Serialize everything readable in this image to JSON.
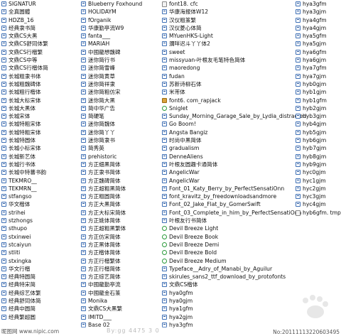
{
  "col1": [
    {
      "t": "SIGNATUR",
      "i": "ttf"
    },
    {
      "t": "全真圆體",
      "i": "ttf"
    },
    {
      "t": "HDZB_16",
      "i": "ttf"
    },
    {
      "t": "经典隶书简",
      "i": "ttf"
    },
    {
      "t": "文鼎CS大黑",
      "i": "ttf"
    },
    {
      "t": "文鼎CS舒同体繁",
      "i": "ttf"
    },
    {
      "t": "文鼎CS行楷繁",
      "i": "ttf"
    },
    {
      "t": "文鼎CS中等",
      "i": "ttf"
    },
    {
      "t": "文鼎CS行楷体简",
      "i": "ttf"
    },
    {
      "t": "长城粗隶书体",
      "i": "ttf"
    },
    {
      "t": "长城粗魏碑体",
      "i": "ttf"
    },
    {
      "t": "长城粗行楷体",
      "i": "ttf"
    },
    {
      "t": "长城大标宋体",
      "i": "ttf"
    },
    {
      "t": "长城大黑体",
      "i": "ttf"
    },
    {
      "t": "长城宋体",
      "i": "ttf"
    },
    {
      "t": "长城特粗宋体",
      "i": "ttf"
    },
    {
      "t": "长城特粗宋体",
      "i": "ttf"
    },
    {
      "t": "长城特圆体",
      "i": "ttf"
    },
    {
      "t": "长城小标宋体",
      "i": "ttf"
    },
    {
      "t": "长城新艺体",
      "i": "ttf"
    },
    {
      "t": "长城行书体",
      "i": "ttf"
    },
    {
      "t": "长城中特蕃书韵",
      "i": "ttf"
    },
    {
      "t": "TEKMRO__",
      "i": "ttf"
    },
    {
      "t": "TEKMRN__",
      "i": "ttf"
    },
    {
      "t": "stfangso",
      "i": "ttf"
    },
    {
      "t": "华文楷体",
      "i": "ttf"
    },
    {
      "t": "strihei",
      "i": "ttf"
    },
    {
      "t": "stzhongs",
      "i": "ttf"
    },
    {
      "t": "sthupo",
      "i": "ttf"
    },
    {
      "t": "stxinwei",
      "i": "ttf"
    },
    {
      "t": "stcaiyun",
      "i": "ttf"
    },
    {
      "t": "stliti",
      "i": "ttf"
    },
    {
      "t": "stxingka",
      "i": "ttf"
    },
    {
      "t": "华文行楷",
      "i": "ttf"
    },
    {
      "t": "经典特圆简",
      "i": "ttf"
    },
    {
      "t": "经典特宋简",
      "i": "ttf"
    },
    {
      "t": "经典综艺体繁",
      "i": "ttf"
    },
    {
      "t": "经典舒同体简",
      "i": "ttf"
    },
    {
      "t": "经典中圆简",
      "i": "ttf"
    },
    {
      "t": "经典繁超圆",
      "i": "ttf"
    }
  ],
  "col2": [
    {
      "t": "Blueberry Foxhound",
      "i": "ttf"
    },
    {
      "t": "HOLIDAYM",
      "i": "ttf"
    },
    {
      "t": "fOrganik",
      "i": "ttf"
    },
    {
      "t": "华康勤亭流W9",
      "i": "ttf"
    },
    {
      "t": "fanta___",
      "i": "ttf"
    },
    {
      "t": "MARIAH",
      "i": "ttf"
    },
    {
      "t": "中國龍想魏碑",
      "i": "ttf"
    },
    {
      "t": "迷你简行书",
      "i": "ttf"
    },
    {
      "t": "迷你简雪峰",
      "i": "ttf"
    },
    {
      "t": "迷你简黄草",
      "i": "ttf"
    },
    {
      "t": "迷你简祥隶",
      "i": "ttf"
    },
    {
      "t": "迷你简粗仿宋",
      "i": "ttf"
    },
    {
      "t": "迷你简大黑",
      "i": "ttf"
    },
    {
      "t": "简中华广告",
      "i": "ttf"
    },
    {
      "t": "简硬笔",
      "i": "ttf"
    },
    {
      "t": "迷你简魏体",
      "i": "ttf"
    },
    {
      "t": "迷你简丫丫",
      "i": "ttf"
    },
    {
      "t": "迷你简隶书",
      "i": "ttf"
    },
    {
      "t": "简秀英",
      "i": "ttf"
    },
    {
      "t": "prehistoric",
      "i": "ttf"
    },
    {
      "t": "方正细黑简体",
      "i": "ttf"
    },
    {
      "t": "方正隶书简体",
      "i": "ttf"
    },
    {
      "t": "方正魏碑简体",
      "i": "ttf"
    },
    {
      "t": "方正超粗黑简体",
      "i": "ttf"
    },
    {
      "t": "方正粗圆简体",
      "i": "ttf"
    },
    {
      "t": "方正大黑简体",
      "i": "ttf"
    },
    {
      "t": "方正大标宋简体",
      "i": "ttf"
    },
    {
      "t": "方正姚体简体",
      "i": "ttf"
    },
    {
      "t": "方正超粗黑繁体",
      "i": "ttf"
    },
    {
      "t": "方正仿宋简体",
      "i": "ttf"
    },
    {
      "t": "方正黑体简体",
      "i": "ttf"
    },
    {
      "t": "方正楷体简体",
      "i": "ttf"
    },
    {
      "t": "方正行楷繁体",
      "i": "ttf"
    },
    {
      "t": "方正行楷简体",
      "i": "ttf"
    },
    {
      "t": "方正综艺简体",
      "i": "ttf"
    },
    {
      "t": "中國龍勤亭流",
      "i": "ttf"
    },
    {
      "t": "中國龍金石篆",
      "i": "ttf"
    },
    {
      "t": "Monika",
      "i": "ttf"
    },
    {
      "t": "文鼎CS大黑繁",
      "i": "ttf"
    },
    {
      "t": "IMITD___",
      "i": "ttf"
    },
    {
      "t": "Base 02",
      "i": "ttf"
    }
  ],
  "col3": [
    {
      "t": "font18. cfc",
      "i": "file"
    },
    {
      "t": "华康海报体W12",
      "i": "ttf"
    },
    {
      "t": "汉仪粗篆繁",
      "i": "ttf"
    },
    {
      "t": "汉仪菱心体简",
      "i": "ttf"
    },
    {
      "t": "MYuenHKS-Light",
      "i": "ttf"
    },
    {
      "t": "瀰咩迟斗丫丫体2",
      "i": "ttf"
    },
    {
      "t": "sweet",
      "i": "ttf"
    },
    {
      "t": "missyuan-叶根友毛笔特色简体",
      "i": "ttf"
    },
    {
      "t": "maoredong",
      "i": "ttf"
    },
    {
      "t": "fudan",
      "i": "ttf"
    },
    {
      "t": "苏新诗柳石体",
      "i": "ttf"
    },
    {
      "t": "米芾体",
      "i": "ttf"
    },
    {
      "t": "font6. com_rapjack",
      "i": "fon"
    },
    {
      "t": "Sniglet",
      "i": "otf"
    },
    {
      "t": "Sunday_Morning_Garage_Sale_by_Lydia_distracted",
      "i": "ttf"
    },
    {
      "t": "Go Boom!",
      "i": "ttf"
    },
    {
      "t": "Angsta Bangiz",
      "i": "ttf"
    },
    {
      "t": "时尚中黑简体",
      "i": "ttf"
    },
    {
      "t": "gradualism",
      "i": "ttf"
    },
    {
      "t": "DenneAliens",
      "i": "ttf"
    },
    {
      "t": "叶根友圆趣卡通简体",
      "i": "ttf"
    },
    {
      "t": "AngelicWar",
      "i": "ttf"
    },
    {
      "t": "AngelicWar",
      "i": "ttf"
    },
    {
      "t": "Font_01_Katy_Berry_by_PerfectSensatiOnn",
      "i": "ttf"
    },
    {
      "t": "font_kravitz_by_freedownloadsandmore",
      "i": "ttf"
    },
    {
      "t": "Font_02_Jake_Flat_by_GomerSwift",
      "i": "ttf"
    },
    {
      "t": "Font_03_Complete_in_him_by_PerfectSensatiOnn",
      "i": "ttf"
    },
    {
      "t": "叶根友行书简体",
      "i": "ttf"
    },
    {
      "t": "Devil Breeze Light",
      "i": "otf"
    },
    {
      "t": "Devil Breeze Book",
      "i": "otf"
    },
    {
      "t": "Devil Breeze Demi",
      "i": "otf"
    },
    {
      "t": "Devil Breeze Bold",
      "i": "otf"
    },
    {
      "t": "Devil Breeze Medium",
      "i": "otf"
    },
    {
      "t": "Typeface__Adry_of_Manabi_by_Aguilur",
      "i": "ttf"
    },
    {
      "t": "skirules_sans2_ttf_download_by_protofonts",
      "i": "ttf"
    },
    {
      "t": "文鼎CS楷体",
      "i": "ttf"
    },
    {
      "t": "hya0gfm",
      "i": "ttf"
    },
    {
      "t": "hya0gjm",
      "i": "ttf"
    },
    {
      "t": "hya1gfm",
      "i": "ttf"
    },
    {
      "t": "hya2gjm",
      "i": "ttf"
    },
    {
      "t": "hya3gfm",
      "i": "ttf"
    }
  ],
  "col4": [
    {
      "t": "hya3gfm",
      "i": "ttf"
    },
    {
      "t": "hya3gjm",
      "i": "ttf"
    },
    {
      "t": "hya4gfm",
      "i": "ttf"
    },
    {
      "t": "hya4gjm",
      "i": "ttf"
    },
    {
      "t": "hya5gfm",
      "i": "ttf"
    },
    {
      "t": "hya5gjm",
      "i": "ttf"
    },
    {
      "t": "hya6gfm",
      "i": "ttf"
    },
    {
      "t": "hya6gjm",
      "i": "ttf"
    },
    {
      "t": "hya7gfm",
      "i": "ttf"
    },
    {
      "t": "hya7gjm",
      "i": "ttf"
    },
    {
      "t": "hyb0gjm",
      "i": "ttf"
    },
    {
      "t": "hyb1gjm",
      "i": "ttf"
    },
    {
      "t": "hyb1gfm",
      "i": "ttf"
    },
    {
      "t": "hyb2gjm",
      "i": "ttf"
    },
    {
      "t": "hyb3gjm",
      "i": "ttf"
    },
    {
      "t": "hyb4gjm",
      "i": "ttf"
    },
    {
      "t": "hyb5gjm",
      "i": "ttf"
    },
    {
      "t": "hyb6gjm",
      "i": "ttf"
    },
    {
      "t": "hyb7gjm",
      "i": "ttf"
    },
    {
      "t": "hyb8gjm",
      "i": "ttf"
    },
    {
      "t": "hyb9gjm",
      "i": "ttf"
    },
    {
      "t": "hyc0gjm",
      "i": "ttf"
    },
    {
      "t": "hyc1gjm",
      "i": "ttf"
    },
    {
      "t": "hyc2gjm",
      "i": "ttf"
    },
    {
      "t": "hyc3gjm",
      "i": "ttf"
    },
    {
      "t": "hyc4gjm",
      "i": "ttf"
    },
    {
      "t": "hyb6gfm. tmp",
      "i": "file"
    }
  ],
  "watermark": {
    "left": "昵图网 www.nipic.com",
    "middle": "By:gg 4475 3 0",
    "right": "No:20111113220603495"
  }
}
